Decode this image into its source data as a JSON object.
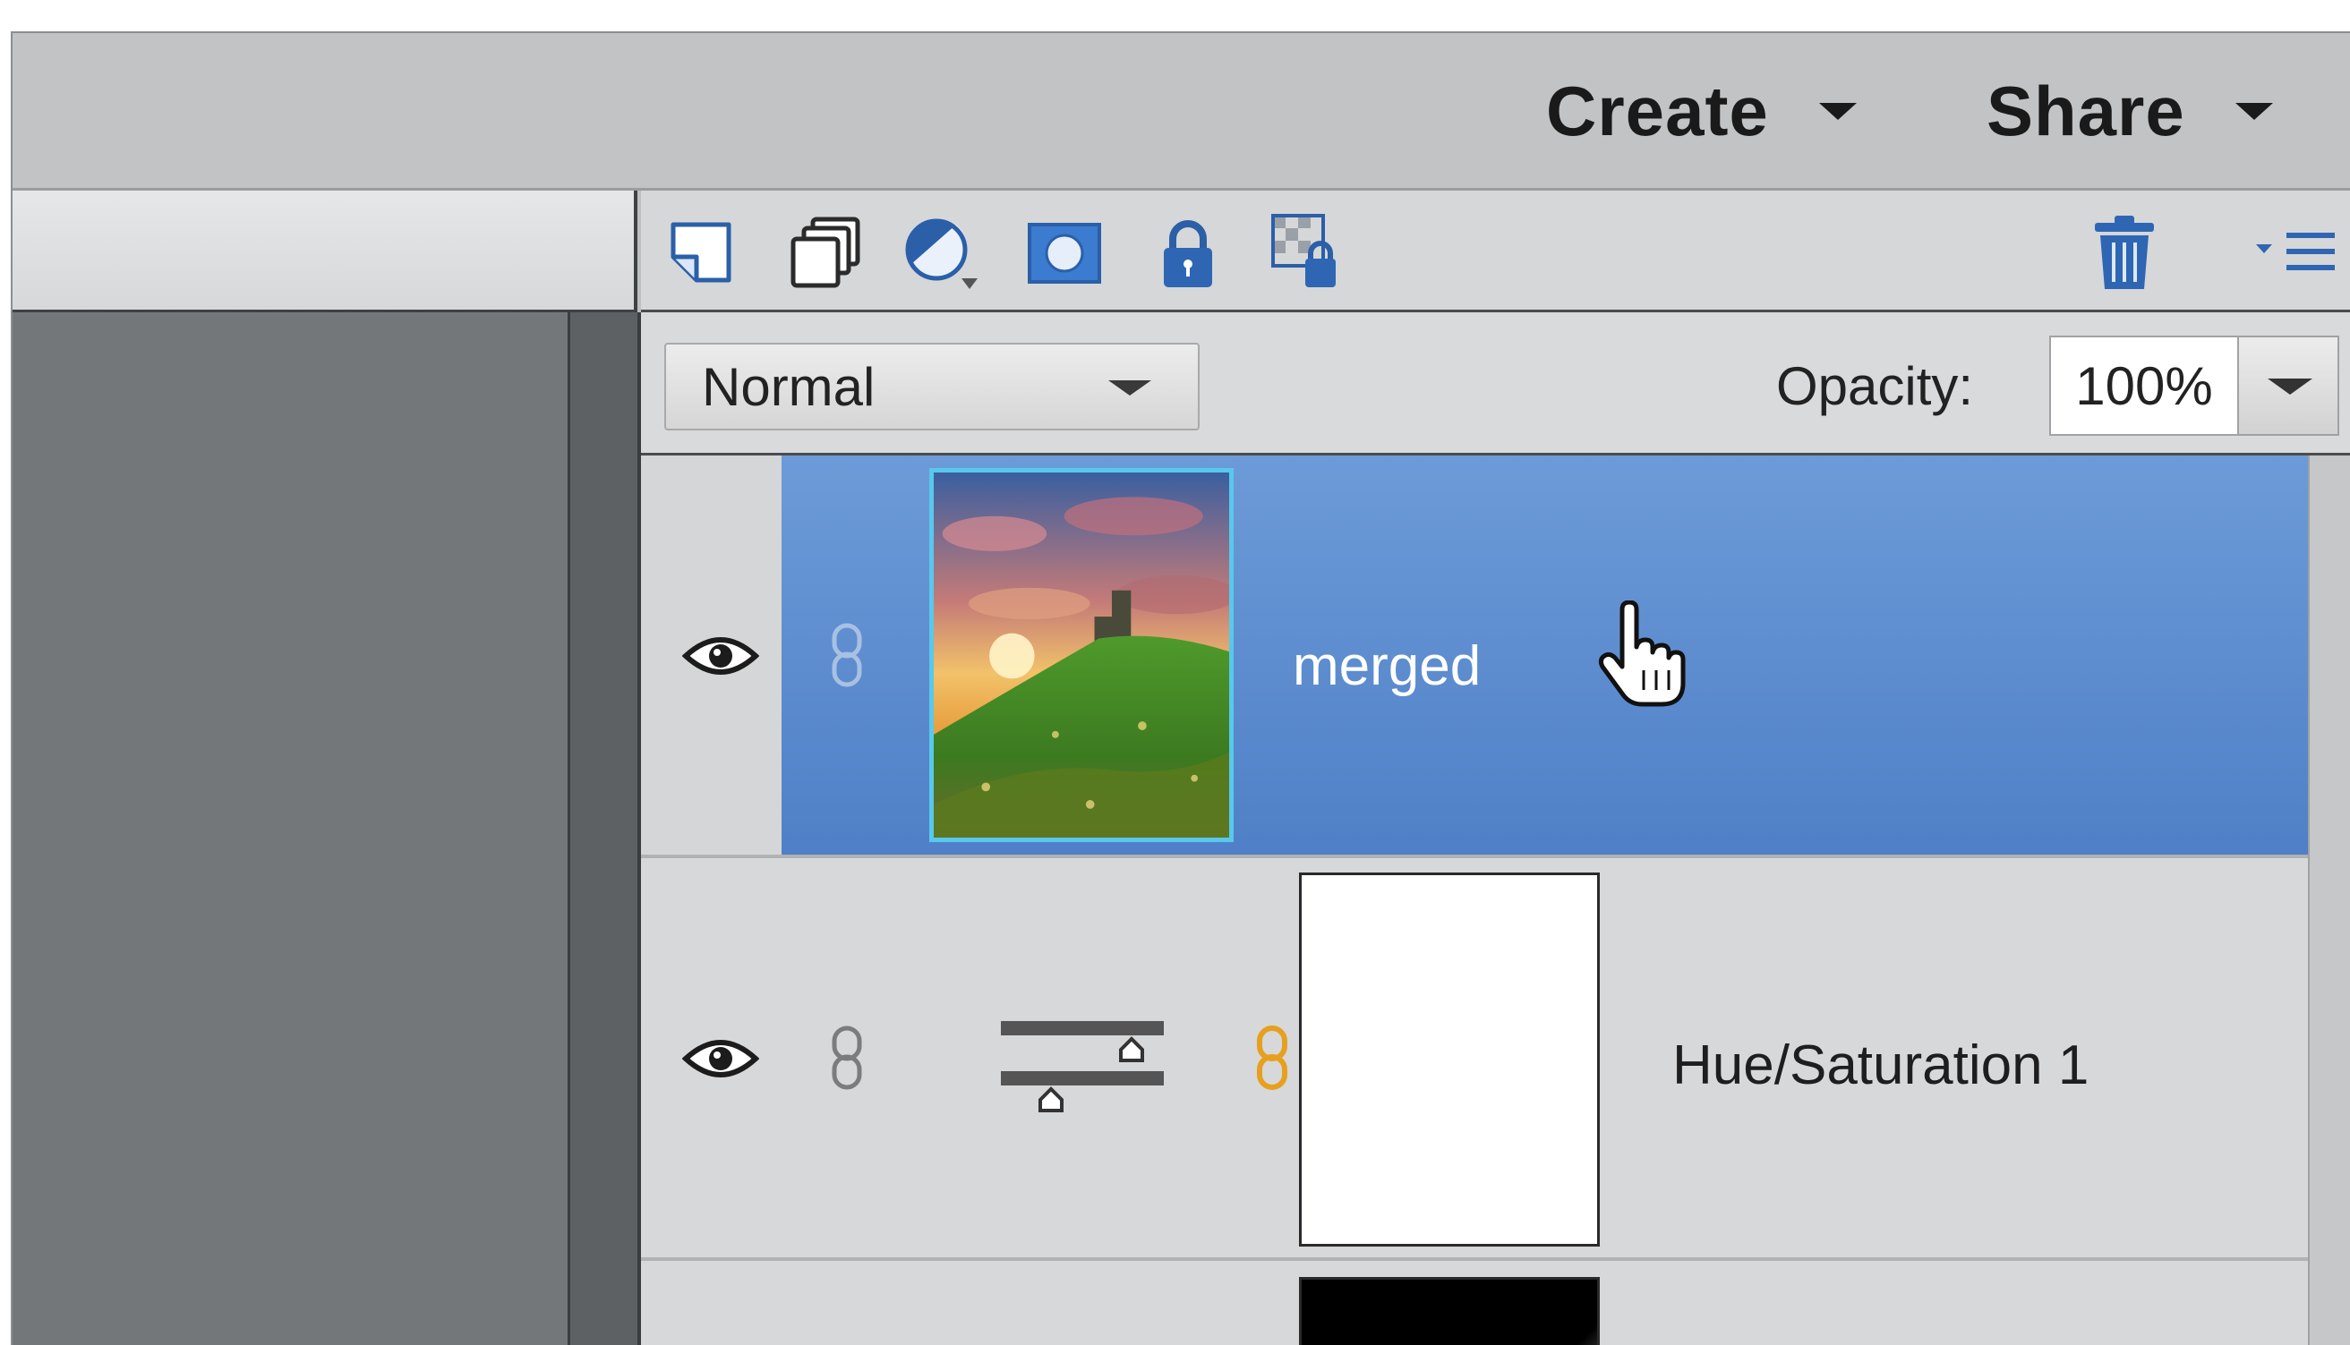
{
  "header": {
    "create_label": "Create",
    "share_label": "Share"
  },
  "toolbar": {
    "icons": [
      "new-layer-icon",
      "new-group-icon",
      "adjustment-layer-icon",
      "layer-mask-icon",
      "lock-all-icon",
      "lock-transparency-icon",
      "trash-icon",
      "panel-menu-icon"
    ]
  },
  "blend": {
    "mode": "Normal",
    "opacity_label": "Opacity:",
    "opacity_value": "100%"
  },
  "layers": [
    {
      "name": "merged",
      "selected": true,
      "visible": true,
      "type": "pixel"
    },
    {
      "name": "Hue/Saturation 1",
      "selected": false,
      "visible": true,
      "type": "adjustment"
    }
  ],
  "colors": {
    "selection": "#5a8bd0",
    "thumb_border": "#58c8ec",
    "link_active": "#e6a020"
  }
}
